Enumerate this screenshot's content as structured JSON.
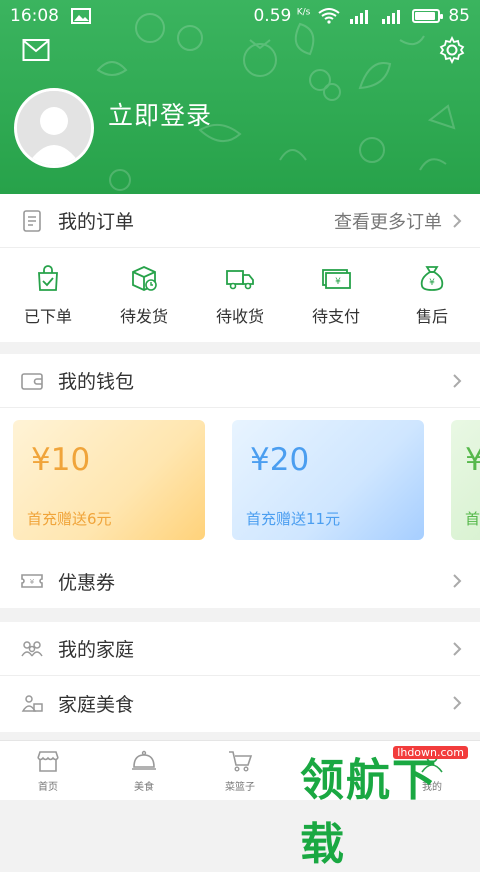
{
  "status_bar": {
    "time": "16:08",
    "speed": "0.59",
    "speed_unit": "K/s",
    "battery": "85",
    "net1": "4G",
    "net2": "3G"
  },
  "header": {
    "login_label": "立即登录"
  },
  "orders": {
    "title": "我的订单",
    "more": "查看更多订单",
    "statuses": [
      {
        "label": "已下单",
        "icon": "bag-check-icon"
      },
      {
        "label": "待发货",
        "icon": "box-clock-icon"
      },
      {
        "label": "待收货",
        "icon": "truck-icon"
      },
      {
        "label": "待支付",
        "icon": "money-icon"
      },
      {
        "label": "售后",
        "icon": "money-bag-icon"
      }
    ]
  },
  "wallet": {
    "title": "我的钱包",
    "cards": [
      {
        "amount": "¥10",
        "note": "首充赠送6元"
      },
      {
        "amount": "¥20",
        "note": "首充赠送11元"
      },
      {
        "amount": "¥",
        "note": "首"
      }
    ]
  },
  "coupon": {
    "label": "优惠券"
  },
  "family": {
    "label": "我的家庭"
  },
  "family_food": {
    "label": "家庭美食"
  },
  "tabbar": {
    "tabs": [
      {
        "label": "首页",
        "icon": "shop-icon"
      },
      {
        "label": "美食",
        "icon": "cloche-icon"
      },
      {
        "label": "菜篮子",
        "icon": "cart-icon"
      },
      {
        "label": "",
        "icon": ""
      },
      {
        "label": "我的",
        "icon": "user-icon"
      }
    ]
  },
  "watermark": {
    "text": "领航下载",
    "url": "lhdown.com"
  },
  "colors": {
    "brand_green": "#27a24a",
    "card_orange": "#f0a43a",
    "card_blue": "#4b9ef0"
  }
}
